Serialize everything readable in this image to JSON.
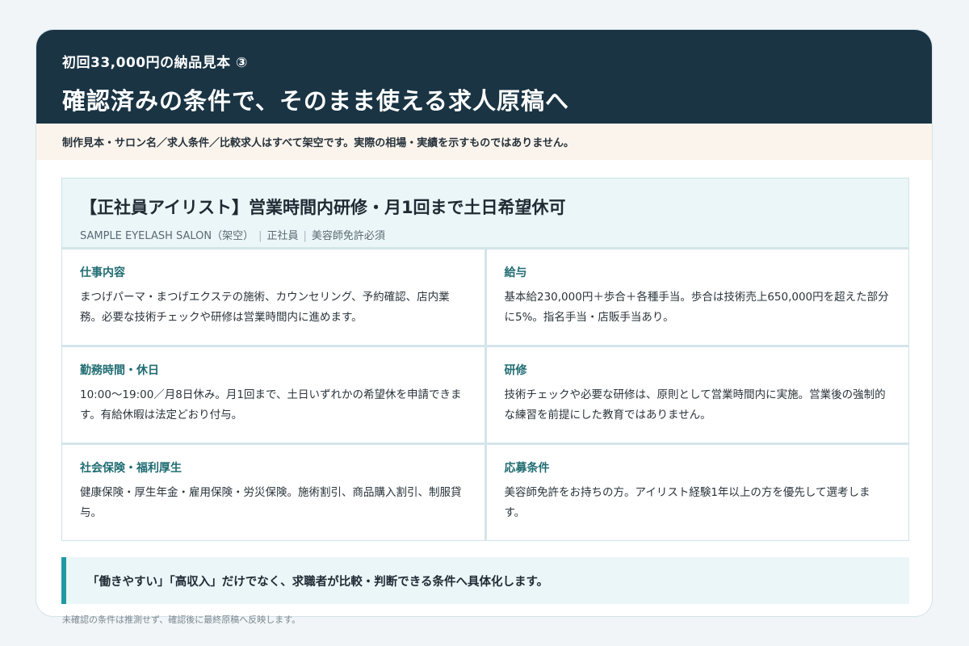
{
  "header": {
    "eyebrow": "初回33,000円の納品見本 ③",
    "headline": "確認済みの条件で、そのまま使える求人原稿へ"
  },
  "notice": "制作見本・サロン名／求人条件／比較求人はすべて架空です。実際の相場・実績を示すものではありません。",
  "job": {
    "title": "【正社員アイリスト】営業時間内研修・月1回まで土日希望休可",
    "salon": "SAMPLE EYELASH SALON（架空）",
    "employment": "正社員",
    "requirement": "美容師免許必須"
  },
  "sections": [
    {
      "title": "仕事内容",
      "body": "まつげパーマ・まつげエクステの施術、カウンセリング、予約確認、店内業務。必要な技術チェックや研修は営業時間内に進めます。"
    },
    {
      "title": "給与",
      "body": "基本給230,000円＋歩合＋各種手当。歩合は技術売上650,000円を超えた部分に5%。指名手当・店販手当あり。"
    },
    {
      "title": "勤務時間・休日",
      "body": "10:00〜19:00／月8日休み。月1回まで、土日いずれかの希望休を申請できます。有給休暇は法定どおり付与。"
    },
    {
      "title": "研修",
      "body": "技術チェックや必要な研修は、原則として営業時間内に実施。営業後の強制的な練習を前提にした教育ではありません。"
    },
    {
      "title": "社会保険・福利厚生",
      "body": "健康保険・厚生年金・雇用保険・労災保険。施術割引、商品購入割引、制服貸与。"
    },
    {
      "title": "応募条件",
      "body": "美容師免許をお持ちの方。アイリスト経験1年以上の方を優先して選考します。"
    }
  ],
  "callout": "「働きやすい」「高収入」だけでなく、求職者が比較・判断できる条件へ具体化します。",
  "footnote": "未確認の条件は推測せず、確認後に最終原稿へ反映します。",
  "colors": {
    "header_bg": "#1a3444",
    "notice_bg": "#fbf4ec",
    "accent": "#1f9aa3",
    "section_title": "#1f6c72"
  }
}
